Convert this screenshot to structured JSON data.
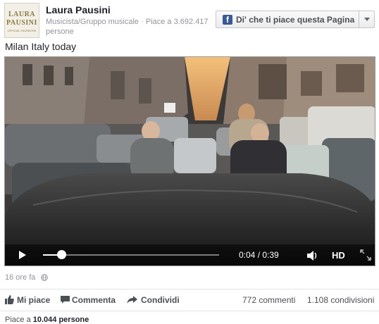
{
  "page": {
    "name": "Laura Pausini",
    "category": "Musicista/Gruppo musicale",
    "likes_text": "Piace a 3.692.417 persone",
    "avatar_line1": "LAURA",
    "avatar_line2": "PAUSINI",
    "avatar_line3": "OFFICIAL FACEBOOK"
  },
  "like_button": {
    "label": "Di' che ti piace questa Pagina",
    "icon": "facebook-f-icon"
  },
  "post": {
    "text": "Milan Italy today",
    "time": "16 ore fa",
    "privacy_icon": "globe-icon"
  },
  "video": {
    "current_time": "0:04",
    "duration": "0:39",
    "time_display": "0:04 / 0:39",
    "progress": 0.1026,
    "hd_label": "HD",
    "icons": [
      "play-icon",
      "volume-icon",
      "fullscreen-icon"
    ]
  },
  "actions": {
    "like": "Mi piace",
    "comment": "Commenta",
    "share": "Condividi",
    "comments_count": "772 commenti",
    "shares_count": "1.108 condivisioni"
  },
  "footer": {
    "likes_prefix": "Piace a",
    "likes_count": "10.044 persone"
  },
  "colors": {
    "facebook_blue": "#3b5998",
    "text_gray": "#90949c"
  }
}
